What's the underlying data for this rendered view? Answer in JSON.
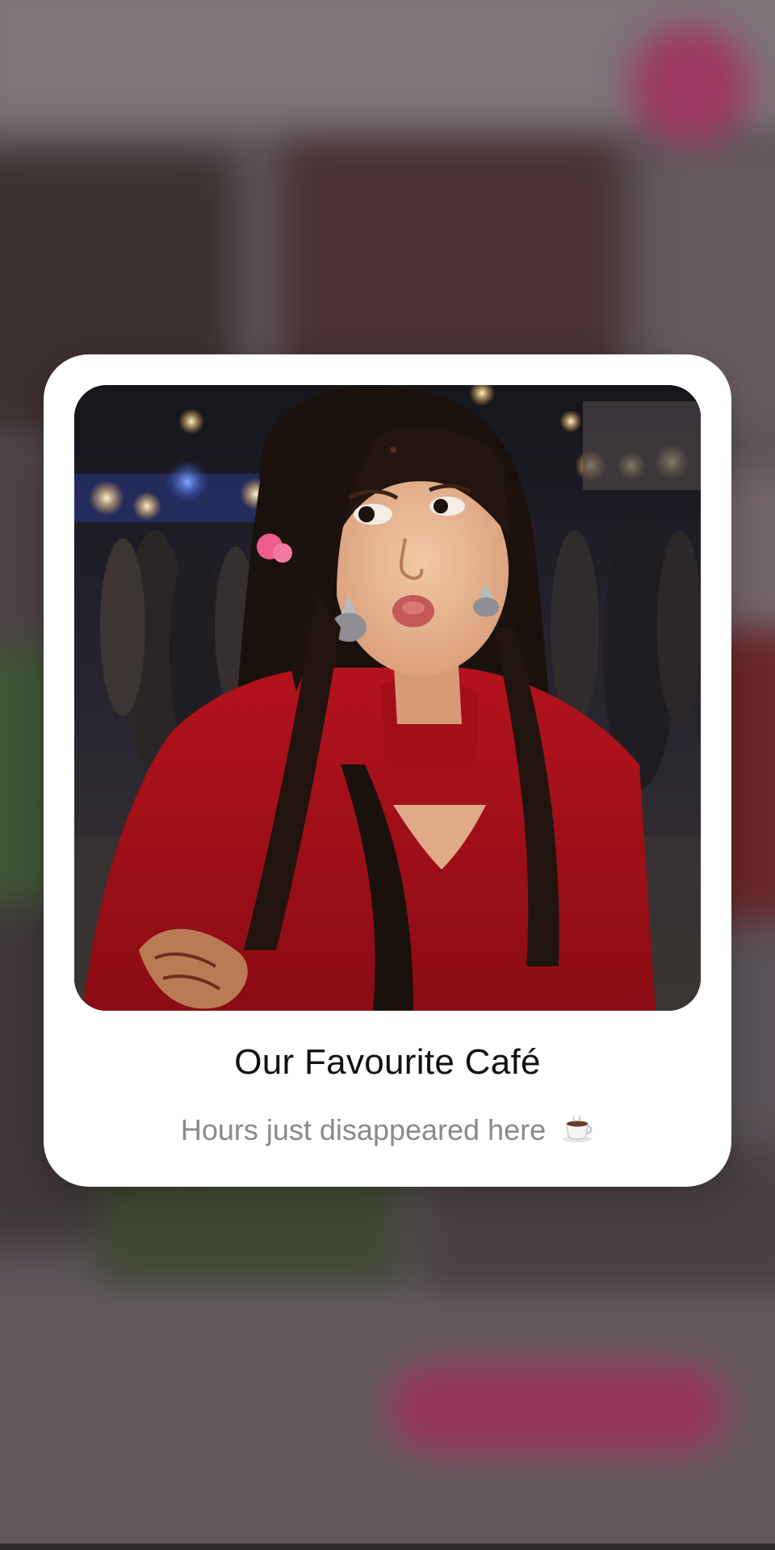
{
  "card": {
    "title": "Our Favourite Café",
    "subtitle": "Hours just disappeared here",
    "subtitle_icon": "coffee-cup-icon",
    "photo_subject": "portrait-photo"
  },
  "colors": {
    "card_background": "#ffffff",
    "title_text": "#111111",
    "subtitle_text": "#8a8a8e",
    "accent_pink": "#b0386a"
  }
}
